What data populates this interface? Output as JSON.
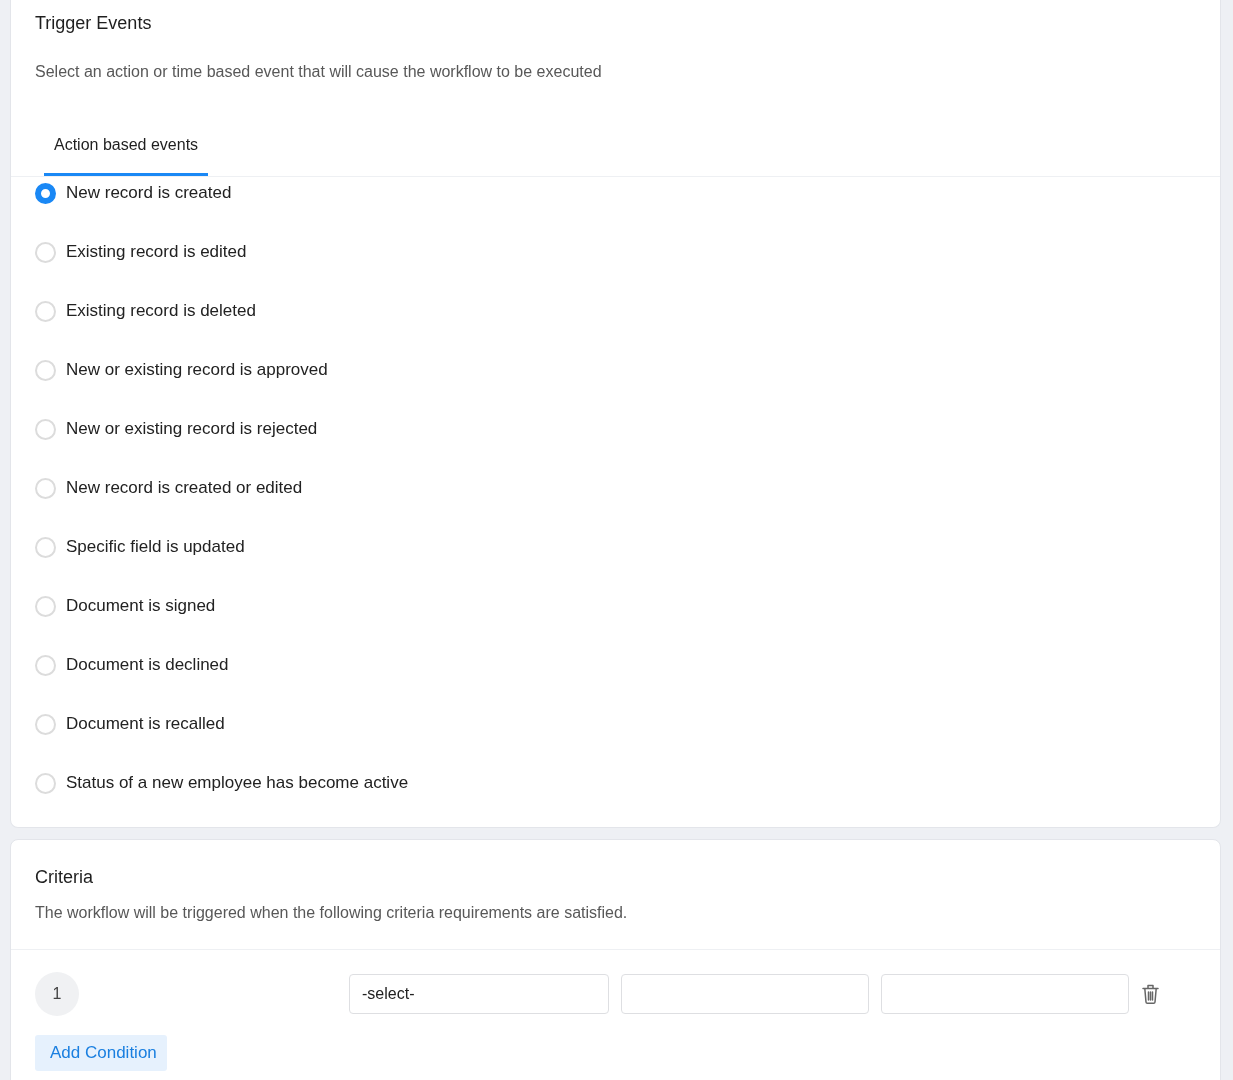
{
  "trigger_events": {
    "title": "Trigger Events",
    "description": "Select an action or time based event that will cause the workflow to be executed",
    "tabs": [
      {
        "label": "Action based events",
        "selected": true
      }
    ],
    "options": [
      {
        "label": "New record is created",
        "selected": true
      },
      {
        "label": "Existing record is edited",
        "selected": false
      },
      {
        "label": "Existing record is deleted",
        "selected": false
      },
      {
        "label": "New or existing record is approved",
        "selected": false
      },
      {
        "label": "New or existing record is rejected",
        "selected": false
      },
      {
        "label": "New record is created or edited",
        "selected": false
      },
      {
        "label": "Specific field is updated",
        "selected": false
      },
      {
        "label": "Document is signed",
        "selected": false
      },
      {
        "label": "Document is declined",
        "selected": false
      },
      {
        "label": "Document is recalled",
        "selected": false
      },
      {
        "label": "Status of a new employee has become active",
        "selected": false
      }
    ]
  },
  "criteria": {
    "title": "Criteria",
    "description": "The workflow will be triggered when the following criteria requirements are satisfied.",
    "conditions": [
      {
        "number": "1",
        "field": "-select-"
      }
    ],
    "add_button": "Add Condition"
  }
}
